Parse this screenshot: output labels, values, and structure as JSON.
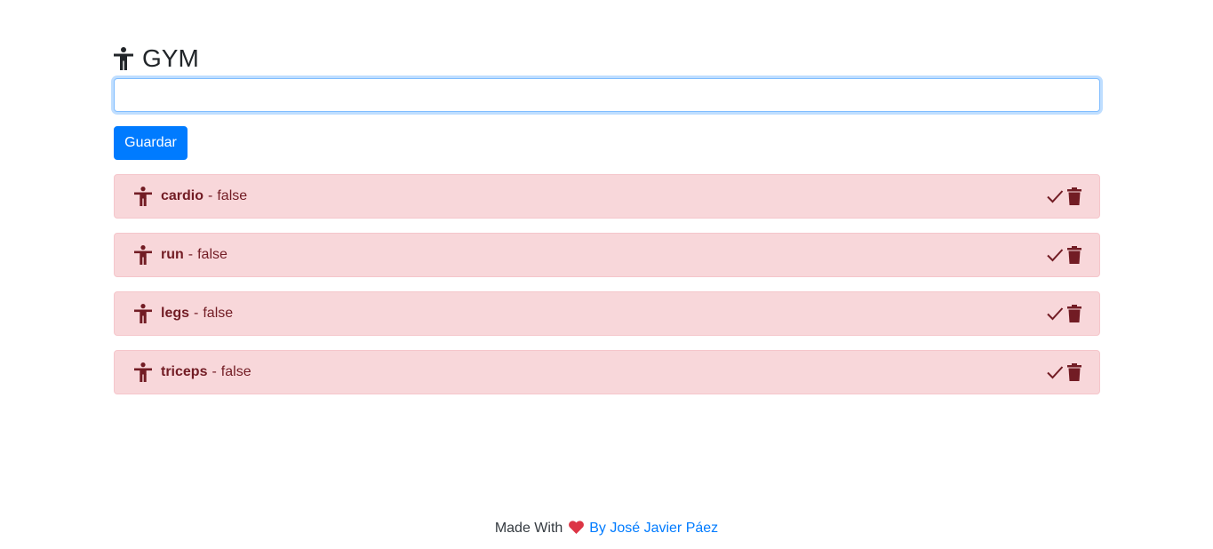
{
  "header": {
    "title": "GYM",
    "icon": "person-icon"
  },
  "form": {
    "input_value": "",
    "save_label": "Guardar"
  },
  "tasks": [
    {
      "name": "cardio",
      "separator": "-",
      "status": "false"
    },
    {
      "name": "run",
      "separator": "-",
      "status": "false"
    },
    {
      "name": "legs",
      "separator": "-",
      "status": "false"
    },
    {
      "name": "triceps",
      "separator": "-",
      "status": "false"
    }
  ],
  "footer": {
    "made_with": "Made With",
    "author_link": "By José Javier Páez"
  },
  "colors": {
    "primary": "#007bff",
    "danger_bg": "#f8d7da",
    "danger_text": "#721c24",
    "heart": "#dc3545"
  }
}
